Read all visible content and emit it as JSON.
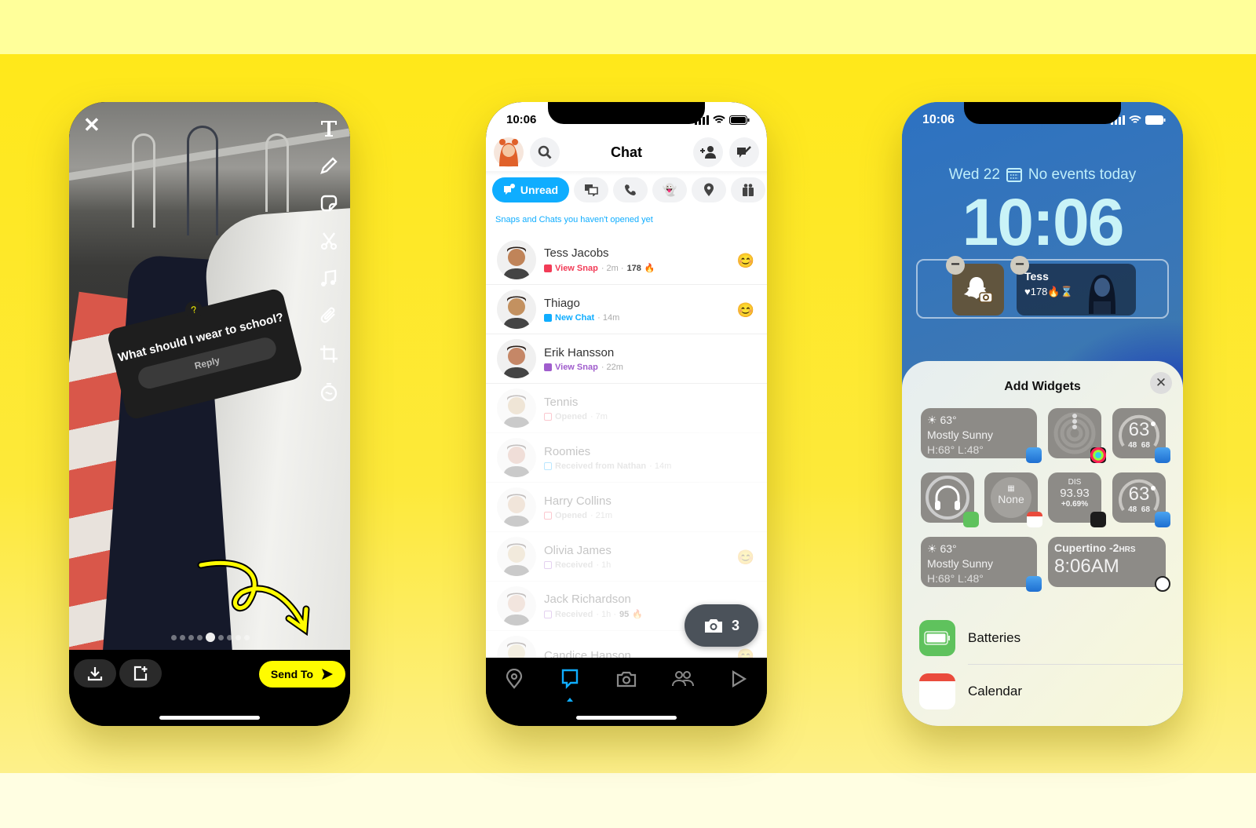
{
  "snap_editor": {
    "poll_question": "What should I wear to school?",
    "poll_reply": "Reply",
    "send_to_label": "Send To",
    "tools": [
      "text-tool",
      "pen-tool",
      "sticker-tool",
      "scissors-tool",
      "music-tool",
      "paperclip-tool",
      "crop-tool",
      "timer-tool"
    ],
    "page_dots": 9,
    "active_dot": 5
  },
  "chat_screen": {
    "status_time": "10:06",
    "title": "Chat",
    "filters": {
      "unread_label": "Unread",
      "others": [
        "chats-icon",
        "call-icon",
        "ghost-icon",
        "location-icon",
        "gift-icon"
      ]
    },
    "hint": "Snaps and Chats you haven't opened yet",
    "conversations": [
      {
        "name": "Tess Jacobs",
        "status": "View Snap",
        "meta": "· 2m ·",
        "streak": "178",
        "streak_icon": "🔥",
        "color": "#f23c57",
        "emoji": "😊",
        "faded": false
      },
      {
        "name": "Thiago",
        "status": "New Chat",
        "meta": "· 14m",
        "streak": "",
        "streak_icon": "",
        "color": "#0fadff",
        "emoji": "😊",
        "faded": false
      },
      {
        "name": "Erik Hansson",
        "status": "View Snap",
        "meta": "· 22m",
        "streak": "",
        "streak_icon": "",
        "color": "#a05dcd",
        "emoji": "",
        "faded": false
      },
      {
        "name": "Tennis",
        "status": "Opened",
        "meta": "· 7m",
        "streak": "",
        "streak_icon": "",
        "color": "#f23c57",
        "emoji": "",
        "faded": true
      },
      {
        "name": "Roomies",
        "status": "Received from Nathan",
        "meta": "· 14m",
        "streak": "",
        "streak_icon": "",
        "color": "#0fadff",
        "emoji": "",
        "faded": true
      },
      {
        "name": "Harry Collins",
        "status": "Opened",
        "meta": "· 21m",
        "streak": "",
        "streak_icon": "",
        "color": "#f23c57",
        "emoji": "",
        "faded": true
      },
      {
        "name": "Olivia James",
        "status": "Received",
        "meta": "· 1h",
        "streak": "",
        "streak_icon": "",
        "color": "#a05dcd",
        "emoji": "😊",
        "faded": true
      },
      {
        "name": "Jack Richardson",
        "status": "Received",
        "meta": "· 1h ·",
        "streak": "95",
        "streak_icon": "🔥",
        "color": "#a05dcd",
        "emoji": "",
        "faded": true
      },
      {
        "name": "Candice Hanson",
        "status": "",
        "meta": "",
        "streak": "",
        "streak_icon": "",
        "color": "#a05dcd",
        "emoji": "😊",
        "faded": true
      }
    ],
    "camera_fab_count": "3",
    "nav": [
      "map",
      "chat",
      "camera",
      "stories",
      "spotlight"
    ],
    "active_nav": "chat",
    "accent": "#0fadff"
  },
  "lock_screen": {
    "status_time": "10:06",
    "date_line": "Wed 22",
    "events": "No events today",
    "clock": "10:06",
    "widget_friend_name": "Tess",
    "widget_friend_stats": "♥178🔥⌛",
    "sheet_title": "Add Widgets",
    "widgets": {
      "weather_temp": "63°",
      "weather_cond": "Mostly Sunny",
      "weather_hl": "H:68° L:48°",
      "gauge_temp": "63",
      "gauge_low": "48",
      "gauge_high": "68",
      "calendar_none": "None",
      "stock_ticker": "DIS",
      "stock_price": "93.93",
      "stock_change": "+0.69%",
      "clock_city": "Cupertino",
      "clock_offset": "-2",
      "clock_offset_unit": "HRS",
      "clock_time": "8:06AM"
    },
    "apps": [
      "Batteries",
      "Calendar"
    ]
  }
}
